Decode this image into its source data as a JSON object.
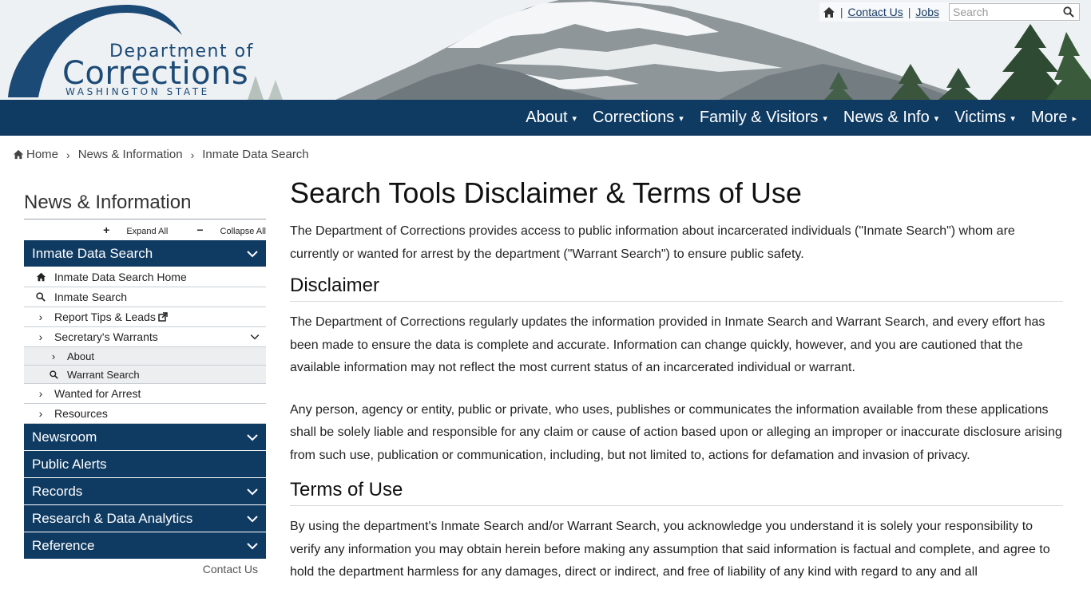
{
  "header": {
    "logo": {
      "line1": "Department of",
      "line2": "Corrections",
      "line3": "WASHINGTON STATE"
    },
    "utility": {
      "home_icon": "home-icon",
      "contact_label": "Contact Us",
      "jobs_label": "Jobs",
      "separator": "|",
      "search_placeholder": "Search",
      "search_icon": "search-icon"
    }
  },
  "nav": {
    "items": [
      {
        "label": "About",
        "caret": "▾"
      },
      {
        "label": "Corrections",
        "caret": "▾"
      },
      {
        "label": "Family & Visitors",
        "caret": "▾"
      },
      {
        "label": "News & Info",
        "caret": "▾"
      },
      {
        "label": "Victims",
        "caret": "▾"
      },
      {
        "label": "More",
        "caret": "▸"
      }
    ]
  },
  "breadcrumb": {
    "items": [
      "Home",
      "News & Information",
      "Inmate Data Search"
    ]
  },
  "sidebar": {
    "title": "News & Information",
    "expand_all": "Expand All",
    "collapse_all": "Collapse All",
    "active_section": "Inmate Data Search",
    "sub_items": {
      "home": "Inmate Data Search Home",
      "search": "Inmate Search",
      "tips": "Report Tips & Leads",
      "warrants": "Secretary's Warrants",
      "warrants_about": "About",
      "warrants_search": "Warrant Search",
      "wanted": "Wanted for Arrest",
      "resources": "Resources"
    },
    "sections": [
      "Newsroom",
      "Public Alerts",
      "Records",
      "Research & Data Analytics",
      "Reference"
    ],
    "contact": "Contact Us"
  },
  "content": {
    "title": "Search Tools Disclaimer & Terms of Use",
    "intro": "The Department of Corrections provides access to public information about incarcerated individuals (\"Inmate Search\") whom are currently or wanted for arrest by the department (\"Warrant Search\") to ensure public safety.",
    "disclaimer_heading": "Disclaimer",
    "disclaimer_p1": "The Department of Corrections regularly updates the information provided in Inmate Search and Warrant Search, and every effort has been made to ensure the data is complete and accurate. Information can change quickly, however, and you are cautioned that the available information may not reflect the most current status of an incarcerated individual or warrant.",
    "disclaimer_p2": "Any person, agency or entity, public or private, who uses, publishes or communicates the information available from these applications shall be solely liable and responsible for any claim or cause of action based upon or alleging an improper or inaccurate disclosure arising from such use, publication or communication, including, but not limited to, actions for defamation and invasion of privacy.",
    "terms_heading": "Terms of Use",
    "terms_p1": "By using the department's Inmate Search and/or Warrant Search, you acknowledge you understand it is solely your responsibility to verify any information you may obtain herein before making any assumption that said information is factual and complete, and agree to hold the department harmless for any damages, direct or indirect, and free of liability of any kind with regard to any and all"
  },
  "colors": {
    "navy": "#0f3b63",
    "logo_blue": "#1c4a77"
  }
}
